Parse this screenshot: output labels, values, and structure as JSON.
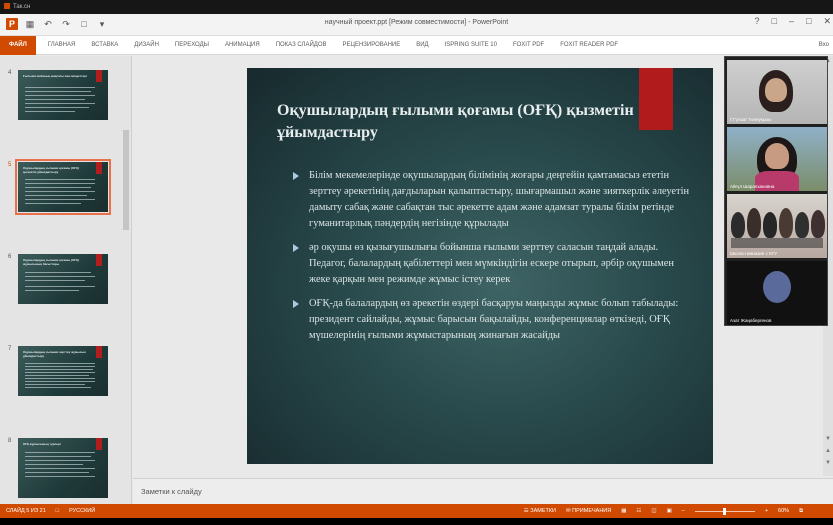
{
  "top_strip": {
    "label": "Так.сн"
  },
  "titlebar": {
    "doc_title": "научный проект.ppt [Режим совместимости] - PowerPoint"
  },
  "ribbon": {
    "tabs": [
      "ФАЙЛ",
      "ГЛАВНАЯ",
      "ВСТАВКА",
      "ДИЗАЙН",
      "ПЕРЕХОДЫ",
      "АНИМАЦИЯ",
      "ПОКАЗ СЛАЙДОВ",
      "РЕЦЕНЗИРОВАНИЕ",
      "ВИД",
      "ISPRING SUITE 10",
      "FOXIT PDF",
      "FOXIT READER PDF"
    ],
    "right_label": "Вхо"
  },
  "thumbnails": [
    {
      "num": "4",
      "title": "Ғылыми жобаның мақсаты мен міндеттері"
    },
    {
      "num": "5",
      "title": "Оқушылардың ғылыми қоғамы (ОҒҚ) қызметін ұйымдастыру"
    },
    {
      "num": "6",
      "title": "Оқушылардың ғылыми қоғамы (ОҒҚ) жұмысының бағыттары"
    },
    {
      "num": "7",
      "title": "Оқушылардың ғылыми зерттеу жұмысын ұйымдастыру"
    },
    {
      "num": "8",
      "title": "ОҒҚ жұмысының түрлері"
    }
  ],
  "slide": {
    "title": "Оқушылардың ғылыми қоғамы (ОҒҚ) қызметін ұйымдастыру",
    "bullets": [
      "Білім мекемелерінде оқушылардың білімінің жоғары деңгейін қамтамасыз ететін зерттеу әрекетінің дағдыларын қалыптастыру, шығармашыл және зияткерлік әлеуетін дамыту сабақ және сабақтан тыс әрекетте адам және адамзат туралы білім ретінде гуманитарлық пәндердің негізінде құрылады",
      "әр оқушы өз қызығушылығы бойынша ғылыми зерттеу саласын таңдай алады. Педагог, балалардың қабілеттері мен мүмкіндігін ескере отырып, әрбір оқушымен жеке қарқын мен режимде жұмыс істеу керек",
      "ОҒҚ-да балалардың өз әрекетін өздері басқаруы маңызды жұмыс болып табылады: президент сайлайды, жұмыс барысын бақылайды, конференциялар өткізеді, ОҒҚ мүшелерінің ғылыми жұмыстарының жинағын жасайды"
    ]
  },
  "notes": {
    "placeholder": "Заметки к слайду"
  },
  "video_call": {
    "participants": [
      {
        "name": "Г.Гүлзат Төлеуқызы"
      },
      {
        "name": "Айгүл Шарапхановна"
      },
      {
        "name": "Школа-гимназия с КГУ"
      },
      {
        "name": "Азат Жаңабергенов"
      }
    ]
  },
  "statusbar": {
    "slide_info": "СЛАЙД 5 ИЗ 21",
    "language": "РУССКИЙ",
    "notes_btn": "ЗАМЕТКИ",
    "comments_btn": "ПРИМЕЧАНИЯ",
    "zoom": "60%"
  },
  "colors": {
    "accent": "#d04a02",
    "slide_red": "#b11b1b"
  }
}
